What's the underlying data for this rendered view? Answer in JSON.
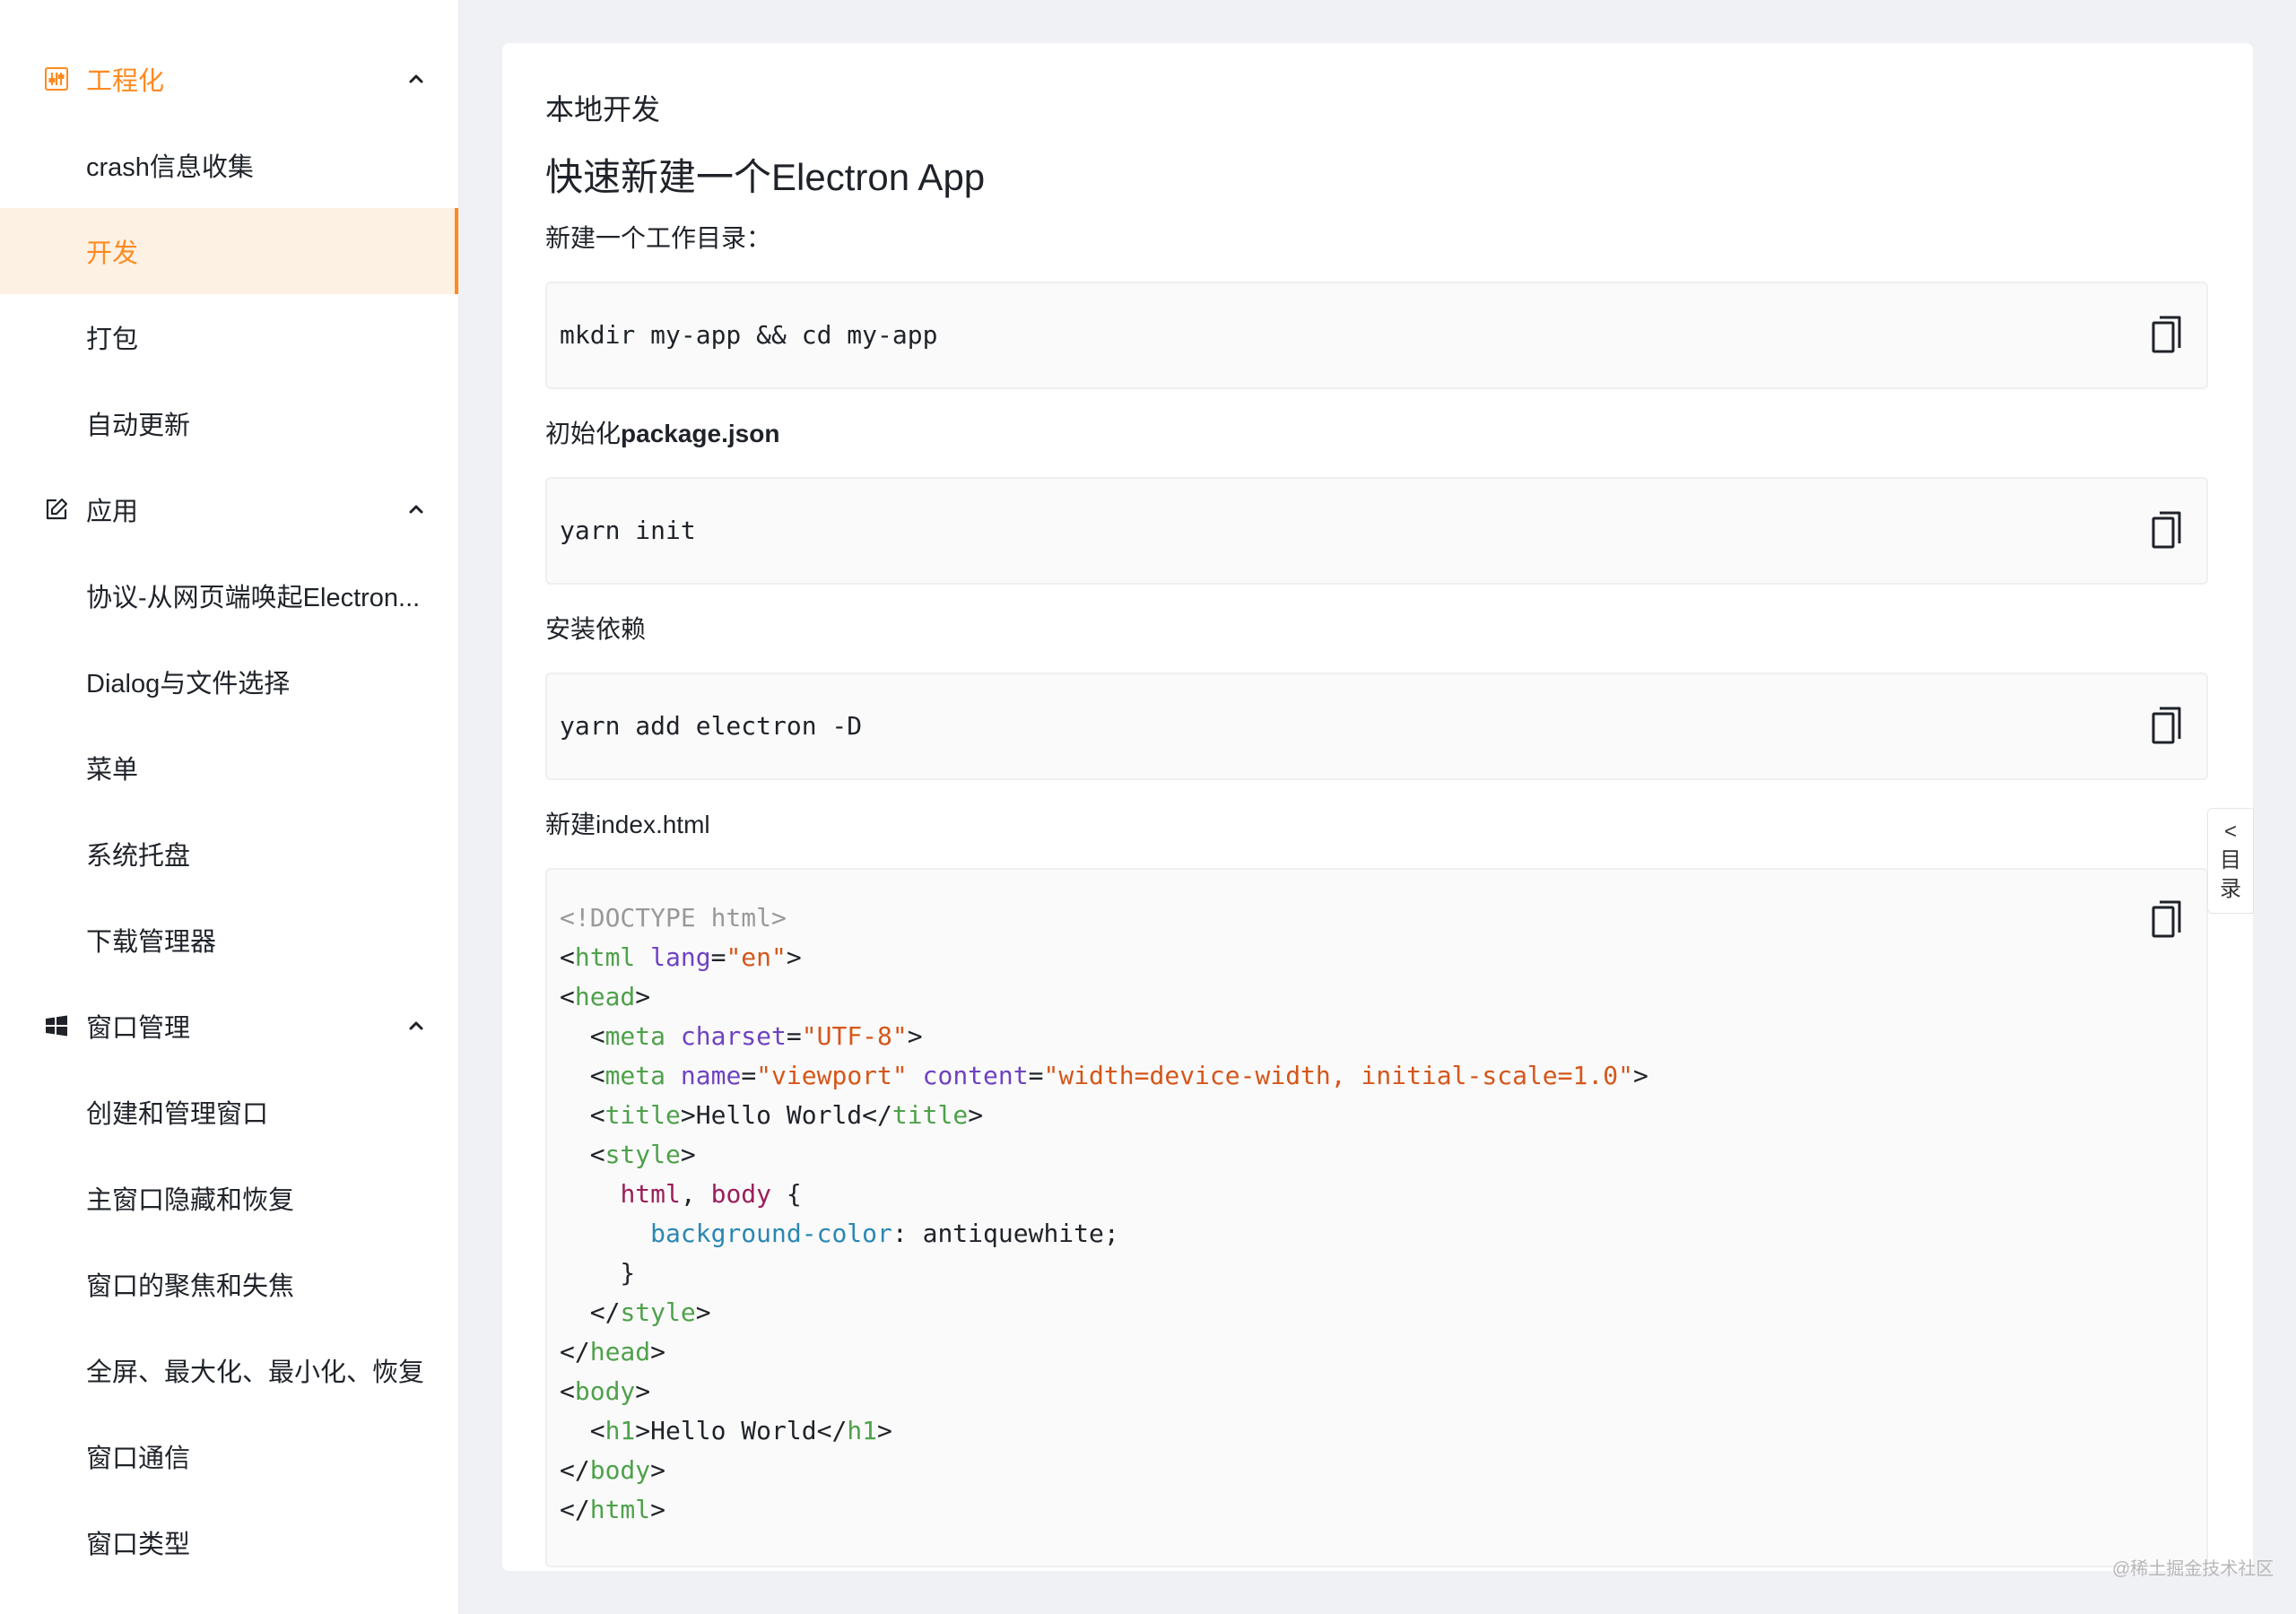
{
  "sidebar": {
    "groups": [
      {
        "title": "工程化",
        "icon": "engineering-icon",
        "color": "#ff8a21",
        "expanded": true,
        "items": [
          "crash信息收集",
          "开发",
          "打包",
          "自动更新"
        ]
      },
      {
        "title": "应用",
        "icon": "edit-icon",
        "expanded": true,
        "items": [
          "协议-从网页端唤起Electron...",
          "Dialog与文件选择",
          "菜单",
          "系统托盘",
          "下载管理器"
        ]
      },
      {
        "title": "窗口管理",
        "icon": "windows-icon",
        "expanded": true,
        "items": [
          "创建和管理窗口",
          "主窗口隐藏和恢复",
          "窗口的聚焦和失焦",
          "全屏、最大化、最小化、恢复",
          "窗口通信",
          "窗口类型"
        ]
      }
    ],
    "active_item": "开发",
    "accent_color": "#ff8a21"
  },
  "main": {
    "section_title": "本地开发",
    "heading": "快速新建一个Electron App",
    "steps": [
      {
        "label": "新建一个工作目录：",
        "code": "mkdir my-app && cd my-app"
      },
      {
        "label_prefix": "初始化",
        "label_bold": "package.json",
        "code": "yarn init"
      },
      {
        "label": "安装依赖",
        "code": "yarn add electron -D"
      },
      {
        "label": "新建index.html"
      }
    ],
    "html_code_lines": [
      "<!DOCTYPE html>",
      "<html lang=\"en\">",
      "<head>",
      "  <meta charset=\"UTF-8\">",
      "  <meta name=\"viewport\" content=\"width=device-width, initial-scale=1.0\">",
      "  <title>Hello World</title>",
      "  <style>",
      "    html, body {",
      "      background-color: antiquewhite;",
      "    }",
      "  </style>",
      "</head>",
      "<body>",
      "  <h1>Hello World</h1>",
      "</body>",
      "</html>"
    ],
    "copy_icon": "copy-icon"
  },
  "toc": {
    "chevron": "<",
    "chars": [
      "目",
      "录"
    ]
  },
  "watermark": "@稀土掘金技术社区"
}
